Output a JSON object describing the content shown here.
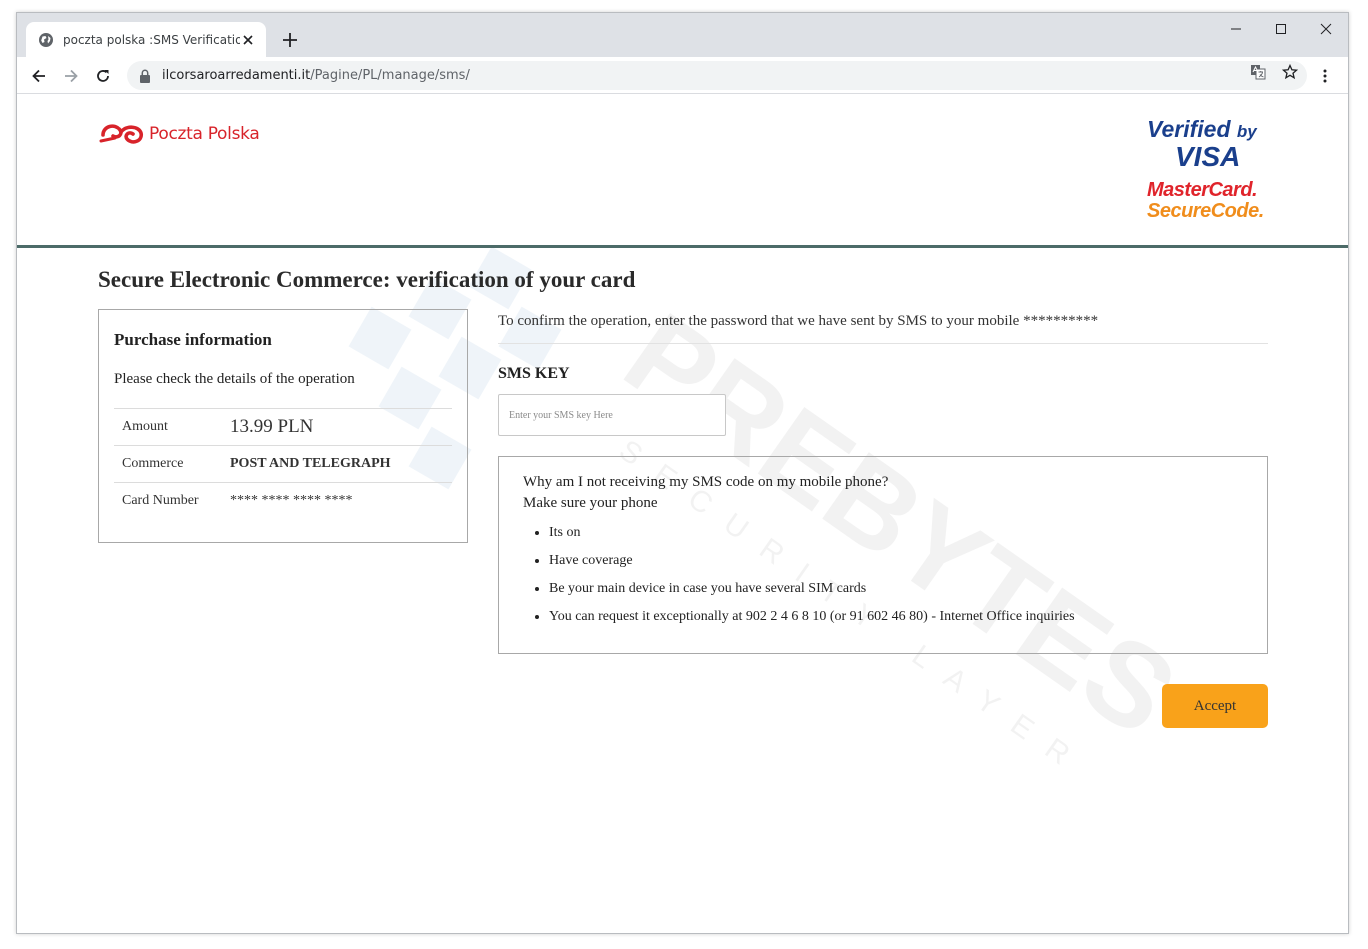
{
  "browser": {
    "tab_title": "poczta polska :SMS Verification",
    "url_host": "ilcorsaroarredamenti.it",
    "url_path": "/Pagine/PL/manage/sms/"
  },
  "header": {
    "brand_name": "Poczta Polska",
    "verified_line1": "Verified",
    "verified_by": "by",
    "verified_line2": "VISA",
    "mastercard_line1": "MasterCard.",
    "mastercard_line2": "SecureCode."
  },
  "page": {
    "heading": "Secure Electronic Commerce: verification of your card"
  },
  "purchase": {
    "title": "Purchase information",
    "subtitle": "Please check the details of the operation",
    "rows": [
      {
        "label": "Amount",
        "value": "13.99 PLN"
      },
      {
        "label": "Commerce",
        "value": "POST AND TELEGRAPH"
      },
      {
        "label": "Card Number",
        "value": "**** **** **** ****"
      }
    ]
  },
  "verification": {
    "instructions": "To confirm the operation, enter the password that we have sent by SMS to your mobile **********",
    "sms_label": "SMS KEY",
    "sms_value": "",
    "sms_placeholder": "Enter your SMS key Here"
  },
  "help": {
    "question": "Why am I not receiving my SMS code on my mobile phone?",
    "intro": "Make sure your phone",
    "items": [
      "Its on",
      "Have coverage",
      "Be your main device in case you have several SIM cards",
      "You can request it exceptionally at 902 2 4 6 8 10 (or 91 602 46 80) - Internet Office inquiries"
    ]
  },
  "actions": {
    "accept_label": "Accept"
  },
  "watermark": {
    "text": "PREBYTES",
    "subtext": "SECURITY LAYER"
  },
  "colors": {
    "brand_red": "#d8232a",
    "divider": "#4c6b68",
    "accept_button": "#f9a21a",
    "visa_blue": "#1a3f8c",
    "mastercard_orange": "#f08d1c"
  },
  "icons": {
    "tab": "globe-icon",
    "tab_close": "close-icon",
    "new_tab": "plus-icon",
    "minimize": "minimize-icon",
    "maximize": "maximize-icon",
    "window_close": "close-icon",
    "back": "arrow-left-icon",
    "forward": "arrow-right-icon",
    "reload": "reload-icon",
    "lock": "lock-icon",
    "translate": "translate-icon",
    "bookmark": "star-icon",
    "menu": "kebab-menu-icon"
  }
}
